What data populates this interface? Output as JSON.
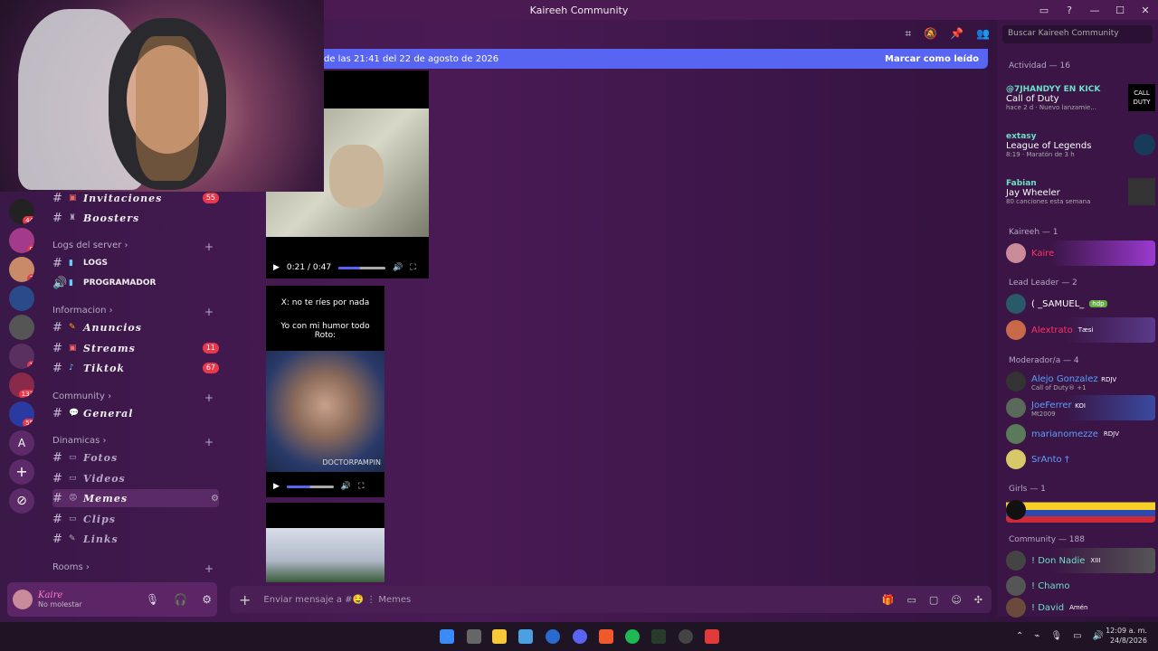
{
  "window": {
    "title": "Kaireeh Community"
  },
  "search": {
    "placeholder": "Buscar Kaireeh Community"
  },
  "banner": {
    "text": "de las 21:41 del 22 de agosto de 2026",
    "action": "Marcar como leído"
  },
  "guild_badges": [
    "44",
    "9",
    "7",
    "1",
    "133",
    "55"
  ],
  "guild_letter": "A",
  "channels": [
    {
      "name": "Invitaciones",
      "count": "55"
    },
    {
      "name": "Boosters",
      "count": ""
    }
  ],
  "categories": {
    "logs": "Logs del server",
    "info": "Informacion",
    "community": "Community",
    "dinamicas": "Dinamicas",
    "rooms": "Rooms"
  },
  "logs_channels": [
    "LOGS",
    "PROGRAMADOR"
  ],
  "info_channels": [
    {
      "name": "Anuncios",
      "count": ""
    },
    {
      "name": "Streams",
      "count": "11"
    },
    {
      "name": "Tiktok",
      "count": "67"
    }
  ],
  "community_channels": [
    "General"
  ],
  "dinamicas_channels": [
    "Fotos",
    "Videos",
    "Memes",
    "Clips",
    "Links"
  ],
  "user": {
    "name": "Kaire",
    "status": "No molestar"
  },
  "video1": {
    "time": "0:21 / 0:47",
    "progress": 0.45
  },
  "video2": {
    "caption1": "X: no te ríes por nada",
    "caption2": "Yo con mi humor todo Roto:",
    "watermark": "DOCTORPAMPIN",
    "progress": 0.5
  },
  "composer": {
    "placeholder": "Enviar mensaje a #🤤 ⋮ Memes"
  },
  "members": {
    "activity_header": "Actividad — 16",
    "activities": [
      {
        "name": "@7JHANDYY EN KICK",
        "game": "Call of Duty",
        "detail": "hace 2 d · Nuevo lanzamie..."
      },
      {
        "name": "extasy",
        "game": "League of Legends",
        "detail": "8:19 · Maratón de 3 h"
      },
      {
        "name": "Fabian",
        "game": "Jay Wheeler",
        "detail": "80 canciones esta semana"
      }
    ],
    "kaireeh_header": "Kaireeh — 1",
    "kaireeh_members": [
      {
        "name": "Kaire",
        "sub": ""
      }
    ],
    "lead_header": "Lead Leader — 2",
    "lead_members": [
      {
        "name": "( _SAMUEL_",
        "sub": "hdp"
      },
      {
        "name": "Alextrato",
        "sub": "Tæsi"
      }
    ],
    "mod_header": "Moderador/a — 4",
    "mod_members": [
      {
        "name": "Alejo Gonzalez",
        "sub": "Call of Duty® +1",
        "tag": "RDJV"
      },
      {
        "name": "JoeFerrer",
        "sub": "Mt2009",
        "tag": "KOI"
      },
      {
        "name": "marianomezze",
        "sub": "",
        "tag": "RDJV"
      },
      {
        "name": "SrAnto †",
        "sub": "",
        "tag": ""
      }
    ],
    "girls_header": "Girls — 1",
    "community_header": "Community — 188",
    "community_members": [
      {
        "name": "! Don Nadie",
        "tag": "XIII"
      },
      {
        "name": "! Chamo",
        "tag": ""
      },
      {
        "name": "! David",
        "tag": "Amén"
      }
    ]
  },
  "clock": {
    "time": "12:09 a. m.",
    "date": "24/8/2026"
  }
}
